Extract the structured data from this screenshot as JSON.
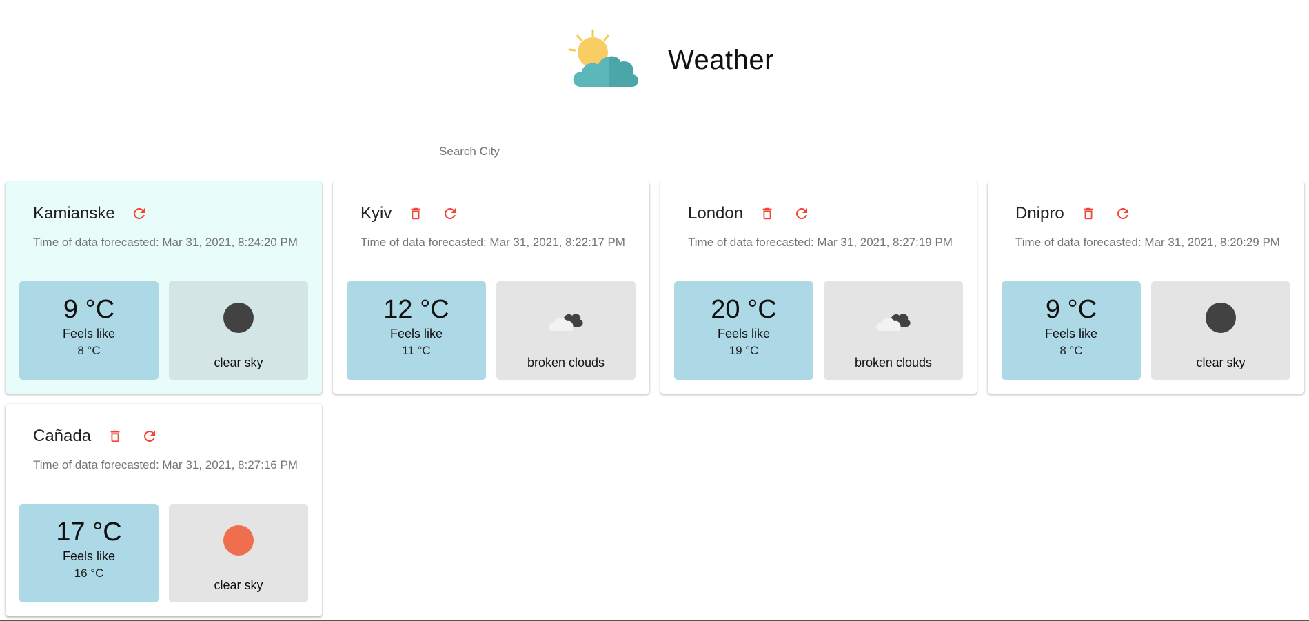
{
  "header": {
    "title": "Weather",
    "logo_icon": "sun-cloud-icon"
  },
  "search": {
    "placeholder": "Search City",
    "value": ""
  },
  "colors": {
    "accent_red": "#f44336",
    "temp_tile": "#add8e6",
    "cond_tile": "#e4e4e4",
    "active_card": "#e8fdf9"
  },
  "cards": [
    {
      "city": "Kamianske",
      "time_label": "Time of data forecasted: Mar 31, 2021, 8:24:20 PM",
      "temp": "9 °C",
      "feels_label": "Feels like",
      "feels": "8 °C",
      "condition": "clear sky",
      "condition_icon": "clear-night-icon",
      "active": true,
      "has_delete": false
    },
    {
      "city": "Kyiv",
      "time_label": "Time of data forecasted: Mar 31, 2021, 8:22:17 PM",
      "temp": "12 °C",
      "feels_label": "Feels like",
      "feels": "11 °C",
      "condition": "broken clouds",
      "condition_icon": "broken-clouds-icon",
      "active": false,
      "has_delete": true
    },
    {
      "city": "London",
      "time_label": "Time of data forecasted: Mar 31, 2021, 8:27:19 PM",
      "temp": "20 °C",
      "feels_label": "Feels like",
      "feels": "19 °C",
      "condition": "broken clouds",
      "condition_icon": "broken-clouds-icon",
      "active": false,
      "has_delete": true
    },
    {
      "city": "Dnipro",
      "time_label": "Time of data forecasted: Mar 31, 2021, 8:20:29 PM",
      "temp": "9 °C",
      "feels_label": "Feels like",
      "feels": "8 °C",
      "condition": "clear sky",
      "condition_icon": "clear-night-icon",
      "active": false,
      "has_delete": true
    },
    {
      "city": "Cañada",
      "time_label": "Time of data forecasted: Mar 31, 2021, 8:27:16 PM",
      "temp": "17 °C",
      "feels_label": "Feels like",
      "feels": "16 °C",
      "condition": "clear sky",
      "condition_icon": "clear-day-icon",
      "active": false,
      "has_delete": true
    }
  ]
}
